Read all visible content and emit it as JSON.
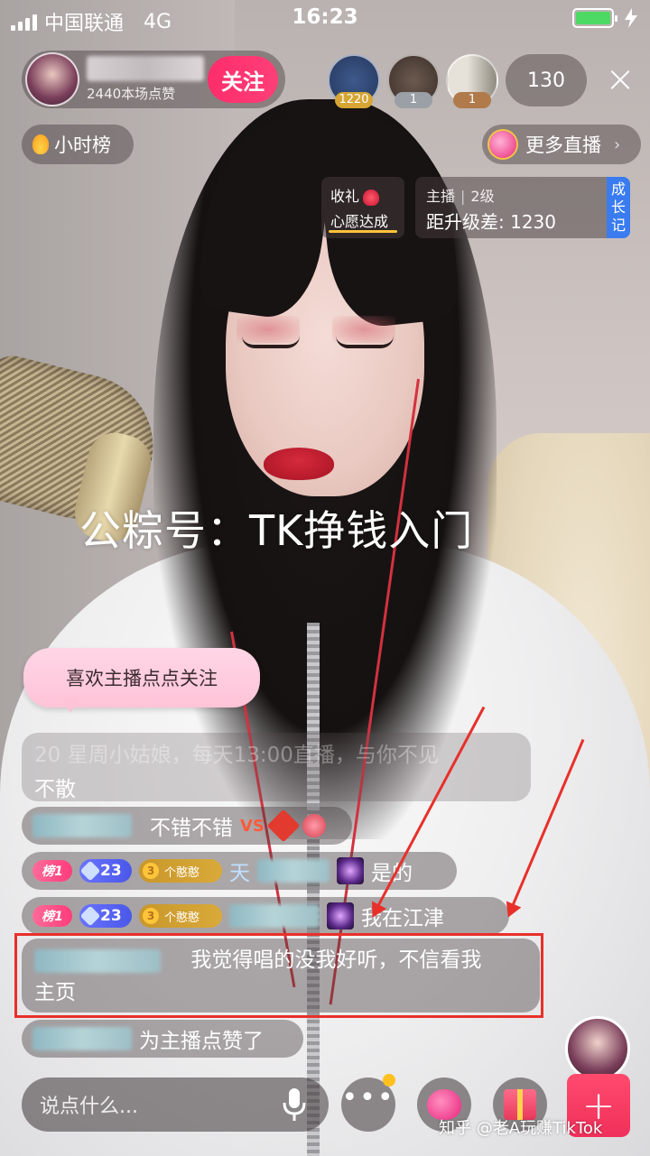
{
  "status_bar": {
    "carrier": "中国联通",
    "network": "4G",
    "time": "16:23"
  },
  "host": {
    "likes_text": "2440本场点赞",
    "follow_label": "关注"
  },
  "viewers": [
    {
      "badge": "1220"
    },
    {
      "badge": "1"
    },
    {
      "badge": "1"
    }
  ],
  "viewer_count": "130",
  "close_icon": "×",
  "hourly_rank_label": "小时榜",
  "more_live_label": "更多直播",
  "chevron": "›",
  "wish_card": {
    "title": "收礼",
    "status": "心愿达成"
  },
  "level_card": {
    "role": "主播",
    "level": "2级",
    "gap_label": "距升级差:",
    "gap_value": "1230",
    "grow_tag": "成长记"
  },
  "watermark": "公粽号：TK挣钱入门",
  "follow_tip": "喜欢主播点点关注",
  "chat": {
    "faded_top": "20 星周小姑娘，每天13:00直播，与你不见",
    "faded_bottom": "不散",
    "msg1": "不错不错",
    "vs": "VS",
    "rank_badge": "榜1",
    "level_badge": "23",
    "fan_level": "3",
    "fan_label": "个憨憨",
    "msg2_prefix": "天",
    "msg2": "是的",
    "msg3": "我在江津",
    "highlight_line1": "我觉得唱的没我好听，不信看我",
    "highlight_line2": "主页",
    "like_msg": "为主播点赞了"
  },
  "input_placeholder": "说点什么...",
  "plus_label": "+",
  "credit": "知乎 @老A玩赚TikTok",
  "colors": {
    "accent_pink": "#ff2d6b",
    "highlight_red": "#e8302a",
    "wish_gold": "#ffc33a",
    "grow_blue": "#3a7cf0"
  }
}
